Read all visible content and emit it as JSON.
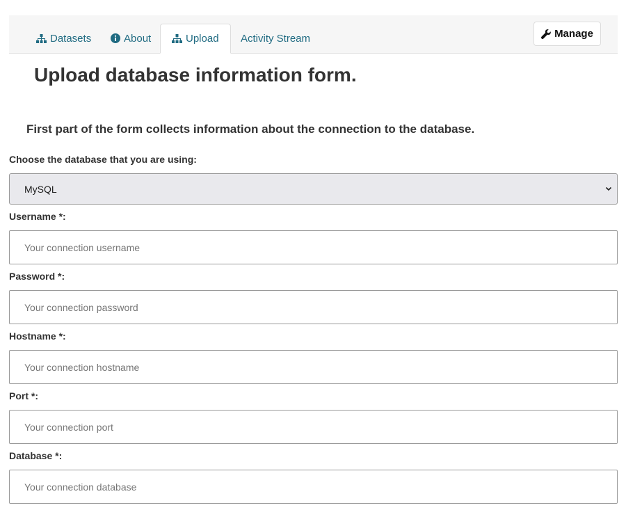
{
  "tabs": {
    "datasets": "Datasets",
    "about": "About",
    "upload": "Upload",
    "activity": "Activity Stream",
    "manage": "Manage"
  },
  "page": {
    "title": "Upload database information form.",
    "subtitle": "First part of the form collects information about the connection to the database."
  },
  "form": {
    "database_label": "Choose the database that you are using:",
    "database_selected": "MySQL",
    "username_label": "Username *:",
    "username_placeholder": "Your connection username",
    "password_label": "Password *:",
    "password_placeholder": "Your connection password",
    "hostname_label": "Hostname *:",
    "hostname_placeholder": "Your connection hostname",
    "port_label": "Port *:",
    "port_placeholder": "Your connection port",
    "database_name_label": "Database *:",
    "database_name_placeholder": "Your connection database"
  },
  "colors": {
    "link": "#206b82",
    "tabbar_bg": "#f6f6f6",
    "select_bg": "#e9e9ed"
  },
  "icons": {
    "datasets": "sitemap-icon",
    "about": "info-circle-icon",
    "upload": "sitemap-icon",
    "manage": "wrench-icon",
    "select": "chevron-down-icon"
  }
}
